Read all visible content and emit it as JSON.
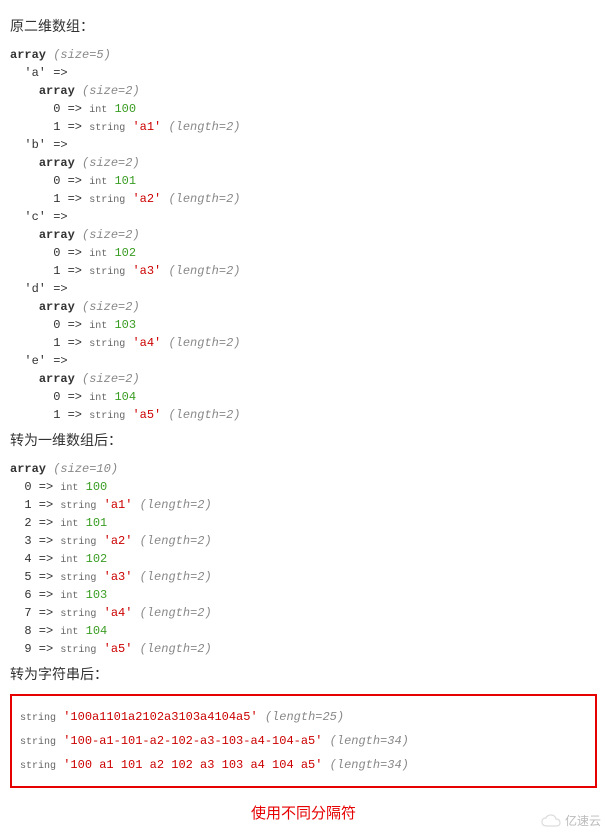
{
  "headings": {
    "h1": "原二维数组：",
    "h2": "转为一维数组后：",
    "h3": "转为字符串后："
  },
  "array2d": {
    "typeLabel": "array",
    "sizeLabel": "(size=5)",
    "itemSizeLabel": "(size=2)",
    "lenLabel": "(length=2)",
    "intLabel": "int",
    "stringLabel": "string",
    "items": [
      {
        "key": "'a'",
        "int": "100",
        "str": "'a1'"
      },
      {
        "key": "'b'",
        "int": "101",
        "str": "'a2'"
      },
      {
        "key": "'c'",
        "int": "102",
        "str": "'a3'"
      },
      {
        "key": "'d'",
        "int": "103",
        "str": "'a4'"
      },
      {
        "key": "'e'",
        "int": "104",
        "str": "'a5'"
      }
    ]
  },
  "array1d": {
    "typeLabel": "array",
    "sizeLabel": "(size=10)",
    "lenLabel": "(length=2)",
    "intLabel": "int",
    "stringLabel": "string",
    "rows": [
      {
        "idx": "0",
        "kind": "int",
        "val": "100"
      },
      {
        "idx": "1",
        "kind": "string",
        "val": "'a1'"
      },
      {
        "idx": "2",
        "kind": "int",
        "val": "101"
      },
      {
        "idx": "3",
        "kind": "string",
        "val": "'a2'"
      },
      {
        "idx": "4",
        "kind": "int",
        "val": "102"
      },
      {
        "idx": "5",
        "kind": "string",
        "val": "'a3'"
      },
      {
        "idx": "6",
        "kind": "int",
        "val": "103"
      },
      {
        "idx": "7",
        "kind": "string",
        "val": "'a4'"
      },
      {
        "idx": "8",
        "kind": "int",
        "val": "104"
      },
      {
        "idx": "9",
        "kind": "string",
        "val": "'a5'"
      }
    ]
  },
  "strings": {
    "label": "string",
    "lines": [
      {
        "val": "'100a1101a2102a3103a4104a5'",
        "len": "(length=25)"
      },
      {
        "val": "'100-a1-101-a2-102-a3-103-a4-104-a5'",
        "len": "(length=34)"
      },
      {
        "val": "'100 a1 101 a2 102 a3 103 a4 104 a5'",
        "len": "(length=34)"
      }
    ]
  },
  "caption": "使用不同分隔符",
  "logo": "亿速云"
}
